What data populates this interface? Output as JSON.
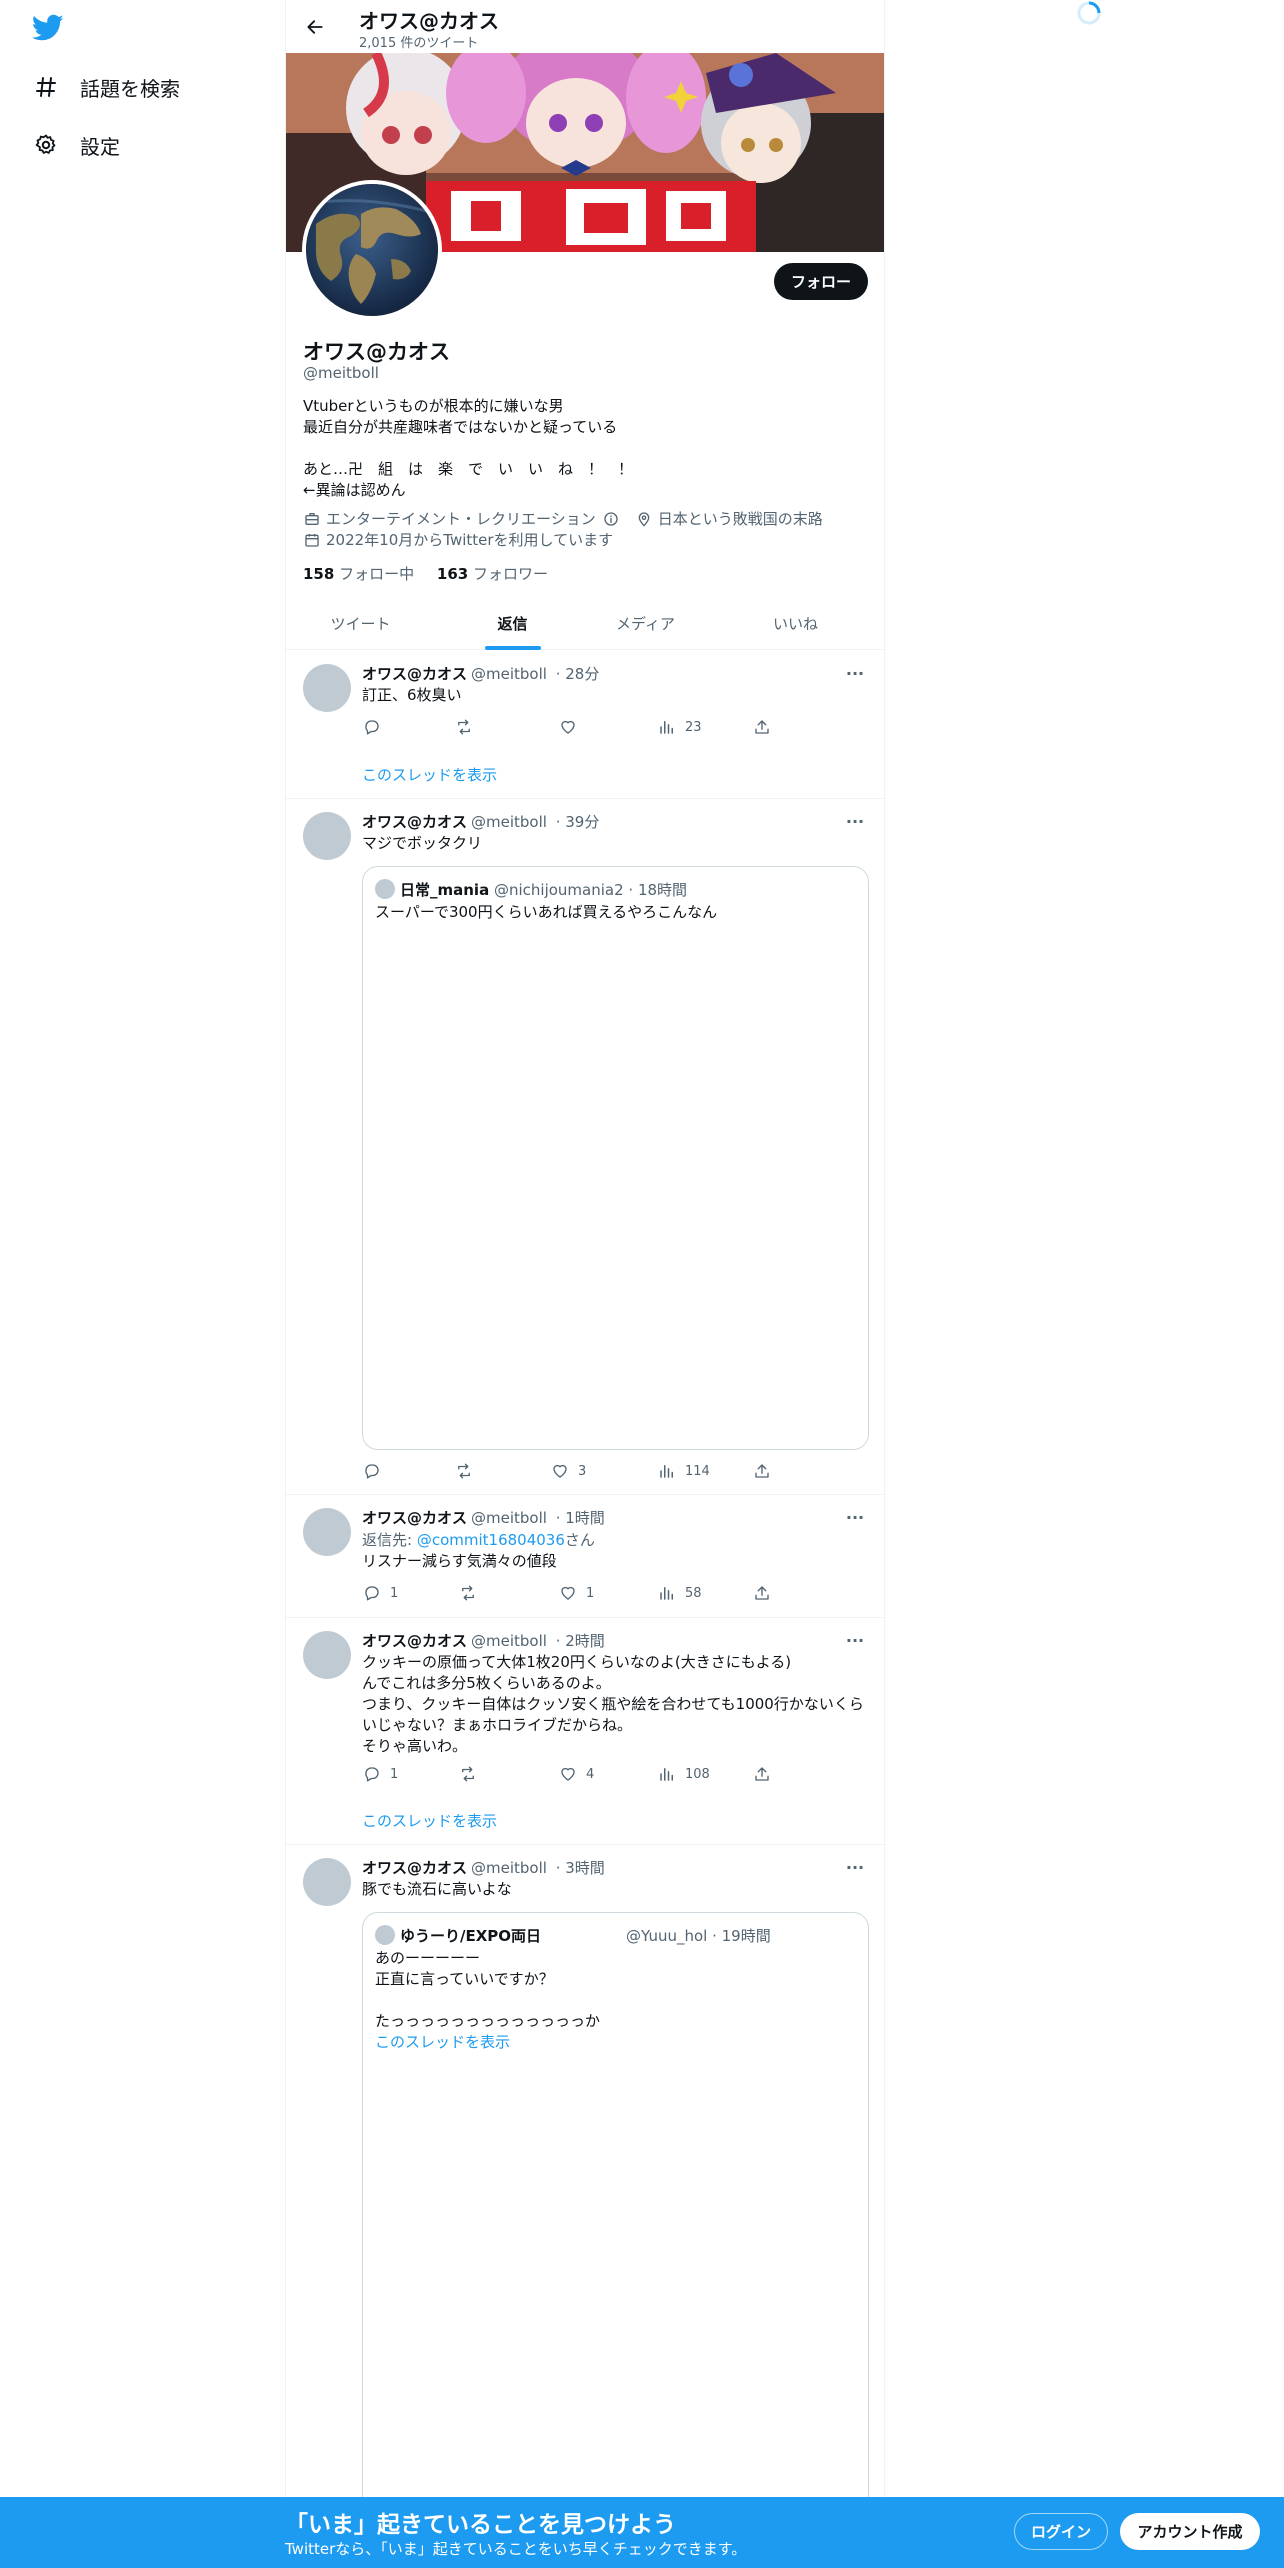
{
  "nav": {
    "items": [
      {
        "label": "話題を検索",
        "icon": "hashtag-icon"
      },
      {
        "label": "設定",
        "icon": "gear-icon"
      }
    ]
  },
  "colors": {
    "accent": "#1d9bf0",
    "text": "#0f1419",
    "muted": "#536471",
    "border": "#eff3f4"
  },
  "header": {
    "name": "オワス@カオス",
    "tweet_count": "2,015 件のツイート"
  },
  "profile": {
    "name": "オワス@カオス",
    "handle": "@meitboll",
    "follow_label": "フォロー",
    "bio": [
      "Vtuberというものが根本的に嫌いな男",
      "最近自分が共産趣味者ではないかと疑っている",
      "",
      "あと…卍　組　は　楽　で　い　い　ね　！　！",
      "←異論は認めん"
    ],
    "category": "エンターテイメント・レクリエーション",
    "location": "日本という敗戦国の末路",
    "joined": "2022年10月からTwitterを利用しています",
    "following_count": "158",
    "following_label": "フォロー中",
    "followers_count": "163",
    "followers_label": "フォロワー"
  },
  "tabs": [
    {
      "label": "ツイート",
      "active": false
    },
    {
      "label": "返信",
      "active": true
    },
    {
      "label": "メディア",
      "active": false
    },
    {
      "label": "いいね",
      "active": false
    }
  ],
  "tweets": [
    {
      "name": "オワス@カオス",
      "handle": "@meitboll",
      "time": "28分",
      "text": [
        "訂正、6枚臭い"
      ],
      "reply": "",
      "retweet": "",
      "like": "",
      "views": "23",
      "thread_link": "このスレッドを表示"
    },
    {
      "name": "オワス@カオス",
      "handle": "@meitboll",
      "time": "39分",
      "text": [
        "マジでボッタクリ"
      ],
      "quote": {
        "name": "日常_mania",
        "handle": "@nichijoumania2",
        "time": "18時間",
        "text": [
          "スーパーで300円くらいあれば買えるやろこんなん"
        ]
      },
      "reply": "",
      "retweet": "",
      "like": "3",
      "views": "114"
    },
    {
      "name": "オワス@カオス",
      "handle": "@meitboll",
      "time": "1時間",
      "reply_to_prefix": "返信先: ",
      "reply_to_handle": "@commit16804036",
      "reply_to_suffix": "さん",
      "text": [
        "リスナー減らす気満々の値段"
      ],
      "reply": "1",
      "retweet": "",
      "like": "1",
      "views": "58"
    },
    {
      "name": "オワス@カオス",
      "handle": "@meitboll",
      "time": "2時間",
      "text": [
        "クッキーの原価って大体1枚20円くらいなのよ(大きさにもよる)",
        "んでこれは多分5枚くらいあるのよ。",
        "つまり、クッキー自体はクッソ安く瓶や絵を合わせても1000行かないくら",
        "いじゃない？まぁホロライブだからね。",
        "そりゃ高いわ。"
      ],
      "reply": "1",
      "retweet": "",
      "like": "4",
      "views": "108",
      "thread_link": "このスレッドを表示"
    },
    {
      "name": "オワス@カオス",
      "handle": "@meitboll",
      "time": "3時間",
      "text": [
        "豚でも流石に高いよな"
      ],
      "quote": {
        "name": "ゆうーり/EXPO両日",
        "handle": "@Yuuu_hol",
        "time": "19時間",
        "text": [
          "あのーーーーー",
          "正直に言っていいですか？",
          "",
          "たっっっっっっっっっっっっっか"
        ],
        "thread_link": "このスレッドを表示"
      }
    }
  ],
  "bottom": {
    "title": "「いま」起きていることを見つけよう",
    "subtitle": "Twitterなら、「いま」起きていることをいち早くチェックできます。",
    "login": "ログイン",
    "signup": "アカウント作成"
  }
}
